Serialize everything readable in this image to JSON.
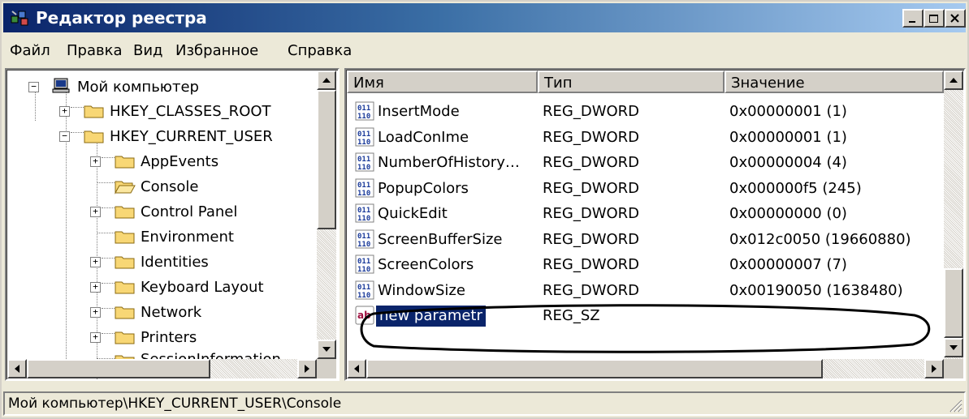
{
  "window": {
    "title": "Редактор реестра"
  },
  "menu": [
    "Файл",
    "Правка",
    "Вид",
    "Избранное",
    "Справка"
  ],
  "tree": {
    "root": "Мой компьютер",
    "items": [
      {
        "label": "HKEY_CLASSES_ROOT",
        "expander": "+"
      },
      {
        "label": "HKEY_CURRENT_USER",
        "expander": "−"
      },
      {
        "label": "AppEvents",
        "expander": "+"
      },
      {
        "label": "Console",
        "expander": ""
      },
      {
        "label": "Control Panel",
        "expander": "+"
      },
      {
        "label": "Environment",
        "expander": ""
      },
      {
        "label": "Identities",
        "expander": "+"
      },
      {
        "label": "Keyboard Layout",
        "expander": "+"
      },
      {
        "label": "Network",
        "expander": "+"
      },
      {
        "label": "Printers",
        "expander": "+"
      },
      {
        "label": "SessionInformation",
        "expander": ""
      }
    ]
  },
  "list": {
    "columns": [
      "Имя",
      "Тип",
      "Значение"
    ],
    "rows": [
      {
        "name": "InsertMode",
        "type": "REG_DWORD",
        "value": "0x00000001 (1)",
        "icon": "dword-icon"
      },
      {
        "name": "LoadConIme",
        "type": "REG_DWORD",
        "value": "0x00000001 (1)",
        "icon": "dword-icon"
      },
      {
        "name": "NumberOfHistory…",
        "type": "REG_DWORD",
        "value": "0x00000004 (4)",
        "icon": "dword-icon"
      },
      {
        "name": "PopupColors",
        "type": "REG_DWORD",
        "value": "0x000000f5 (245)",
        "icon": "dword-icon"
      },
      {
        "name": "QuickEdit",
        "type": "REG_DWORD",
        "value": "0x00000000 (0)",
        "icon": "dword-icon"
      },
      {
        "name": "ScreenBufferSize",
        "type": "REG_DWORD",
        "value": "0x012c0050 (19660880)",
        "icon": "dword-icon"
      },
      {
        "name": "ScreenColors",
        "type": "REG_DWORD",
        "value": "0x00000007 (7)",
        "icon": "dword-icon"
      },
      {
        "name": "WindowSize",
        "type": "REG_DWORD",
        "value": "0x00190050 (1638480)",
        "icon": "dword-icon"
      },
      {
        "name": "new parametr",
        "type": "REG_SZ",
        "value": "",
        "icon": "string-icon"
      }
    ],
    "selected_editing": "new parametr"
  },
  "status": {
    "path": "Мой компьютер\\HKEY_CURRENT_USER\\Console"
  },
  "colors": {
    "titlebar_start": "#0a246a",
    "titlebar_end": "#a6caf0",
    "selection": "#0a246a",
    "face": "#d4d0c8"
  }
}
